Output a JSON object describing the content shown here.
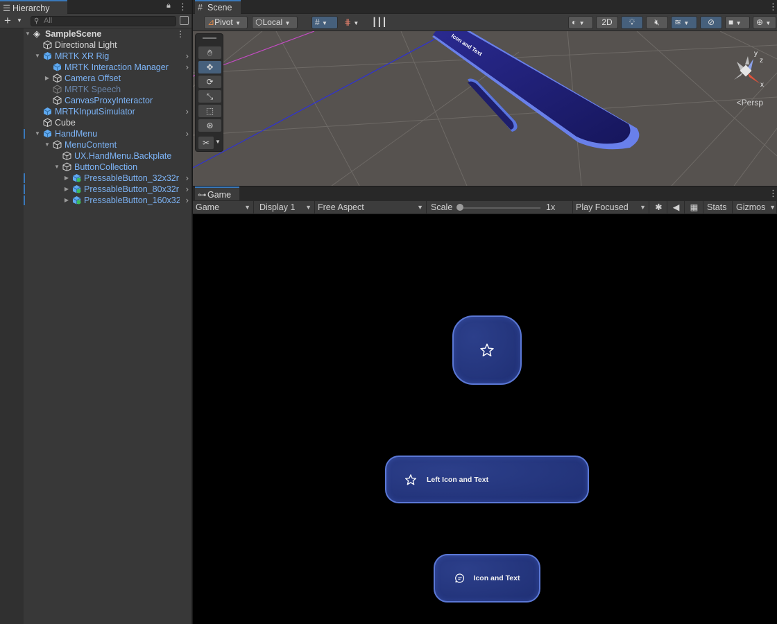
{
  "hierarchy": {
    "tab_label": "Hierarchy",
    "search_placeholder": "All",
    "add_label": "+",
    "items": [
      {
        "label": "SampleScene"
      },
      {
        "label": "Directional Light"
      },
      {
        "label": "MRTK XR Rig"
      },
      {
        "label": "MRTK Interaction Manager"
      },
      {
        "label": "Camera Offset"
      },
      {
        "label": "MRTK Speech"
      },
      {
        "label": "CanvasProxyInteractor"
      },
      {
        "label": "MRTKInputSimulator"
      },
      {
        "label": "Cube"
      },
      {
        "label": "HandMenu"
      },
      {
        "label": "MenuContent"
      },
      {
        "label": "UX.HandMenu.Backplate"
      },
      {
        "label": "ButtonCollection"
      },
      {
        "label": "PressableButton_32x32r"
      },
      {
        "label": "PressableButton_80x32r"
      },
      {
        "label": "PressableButton_160x32"
      }
    ]
  },
  "scene": {
    "tab_label": "Scene",
    "pivot_label": "Pivot",
    "local_label": "Local",
    "mode_2d_label": "2D",
    "persp_label": "Persp",
    "gizmo_y": "y",
    "gizmo_z": "z",
    "gizmo_x": "x",
    "mesh_text": "Icon and Text"
  },
  "game": {
    "tab_label": "Game",
    "mode_select": "Game",
    "display_select": "Display 1",
    "aspect_select": "Free Aspect",
    "scale_label": "Scale",
    "scale_value": "1x",
    "play_mode_select": "Play Focused",
    "stats_label": "Stats",
    "gizmos_label": "Gizmos",
    "buttons": {
      "left_icon_text": "Left Icon and Text",
      "icon_text": "Icon and Text"
    }
  },
  "colors": {
    "accent": "#3a79bb",
    "prefab_blue": "#7cb3f5",
    "button_border": "#5b78d6",
    "button_fill": "#24357c"
  }
}
